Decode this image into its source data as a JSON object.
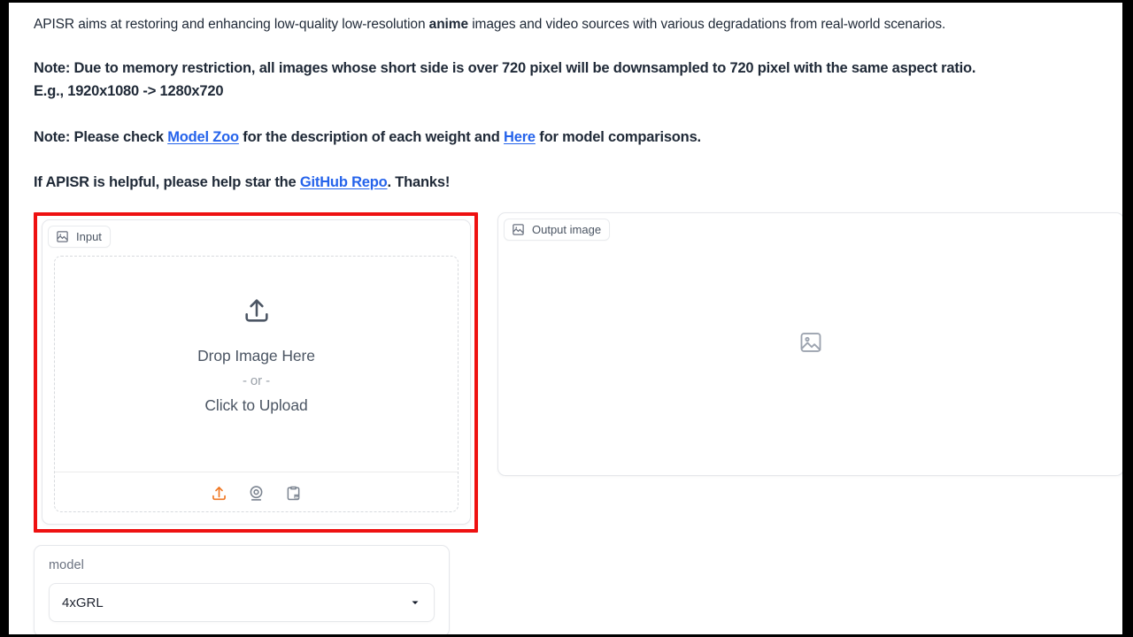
{
  "intro": {
    "line1_pre": "APISR aims at restoring and enhancing low-quality low-resolution ",
    "line1_strong": "anime",
    "line1_post": " images and video sources with various degradations from real-world scenarios.",
    "note_memory_line1": "Note: Due to memory restriction, all images whose short side is over 720 pixel will be downsampled to 720 pixel with the same aspect ratio.",
    "note_memory_line2": "E.g., 1920x1080 -> 1280x720",
    "note_check_pre": "Note: Please check ",
    "note_check_link1": "Model Zoo",
    "note_check_mid": " for the description of each weight and ",
    "note_check_link2": "Here",
    "note_check_post": " for model comparisons.",
    "star_pre": "If APISR is helpful, please help star the ",
    "star_link": "GitHub Repo",
    "star_post": ". Thanks!"
  },
  "input_panel": {
    "label": "Input",
    "label_icon": "image-icon",
    "drop_title": "Drop Image Here",
    "drop_or": "- or -",
    "drop_click": "Click to Upload",
    "upload_icon": "upload-icon",
    "toolbar": [
      {
        "name": "upload-icon",
        "title": "Upload file"
      },
      {
        "name": "webcam-icon",
        "title": "Webcam"
      },
      {
        "name": "clipboard-image-icon",
        "title": "Paste from clipboard"
      }
    ],
    "highlight_color": "#ee1111"
  },
  "output_panel": {
    "label": "Output image",
    "label_icon": "image-icon",
    "placeholder_icon": "image-placeholder-icon"
  },
  "model_selector": {
    "label": "model",
    "value": "4xGRL",
    "caret_icon": "chevron-down-icon"
  },
  "colors": {
    "link": "#2563eb",
    "accent_orange": "#ef7722",
    "highlight_red": "#ee1111",
    "text": "#1f2937"
  }
}
